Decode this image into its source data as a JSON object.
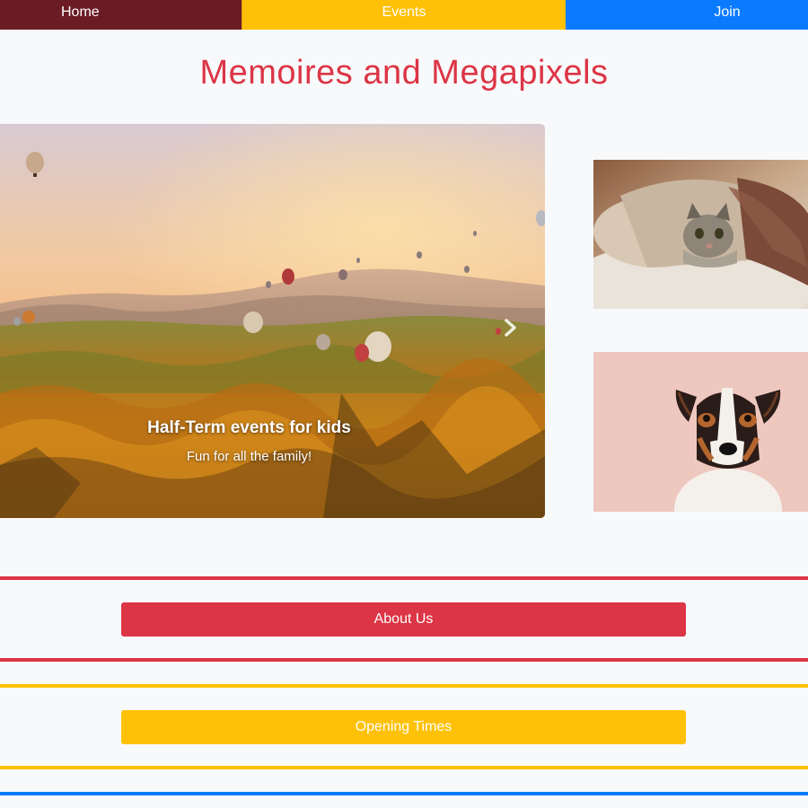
{
  "nav": {
    "home": "Home",
    "events": "Events",
    "join": "Join"
  },
  "page_title": "Memoires and Megapixels",
  "carousel": {
    "caption_title": "Half-Term events for kids",
    "caption_subtitle": "Fun for all the family!",
    "next_icon": "chevron-right-icon"
  },
  "sections": {
    "about": "About Us",
    "opening_times": "Opening Times"
  },
  "colors": {
    "nav_home": "#6b1b24",
    "nav_events": "#ffc107",
    "nav_join": "#0a7bff",
    "title": "#dc3545",
    "about": "#dc3545",
    "opening_times": "#ffc107",
    "rule_blue": "#0a7bff",
    "background": "#f8f9fb"
  }
}
